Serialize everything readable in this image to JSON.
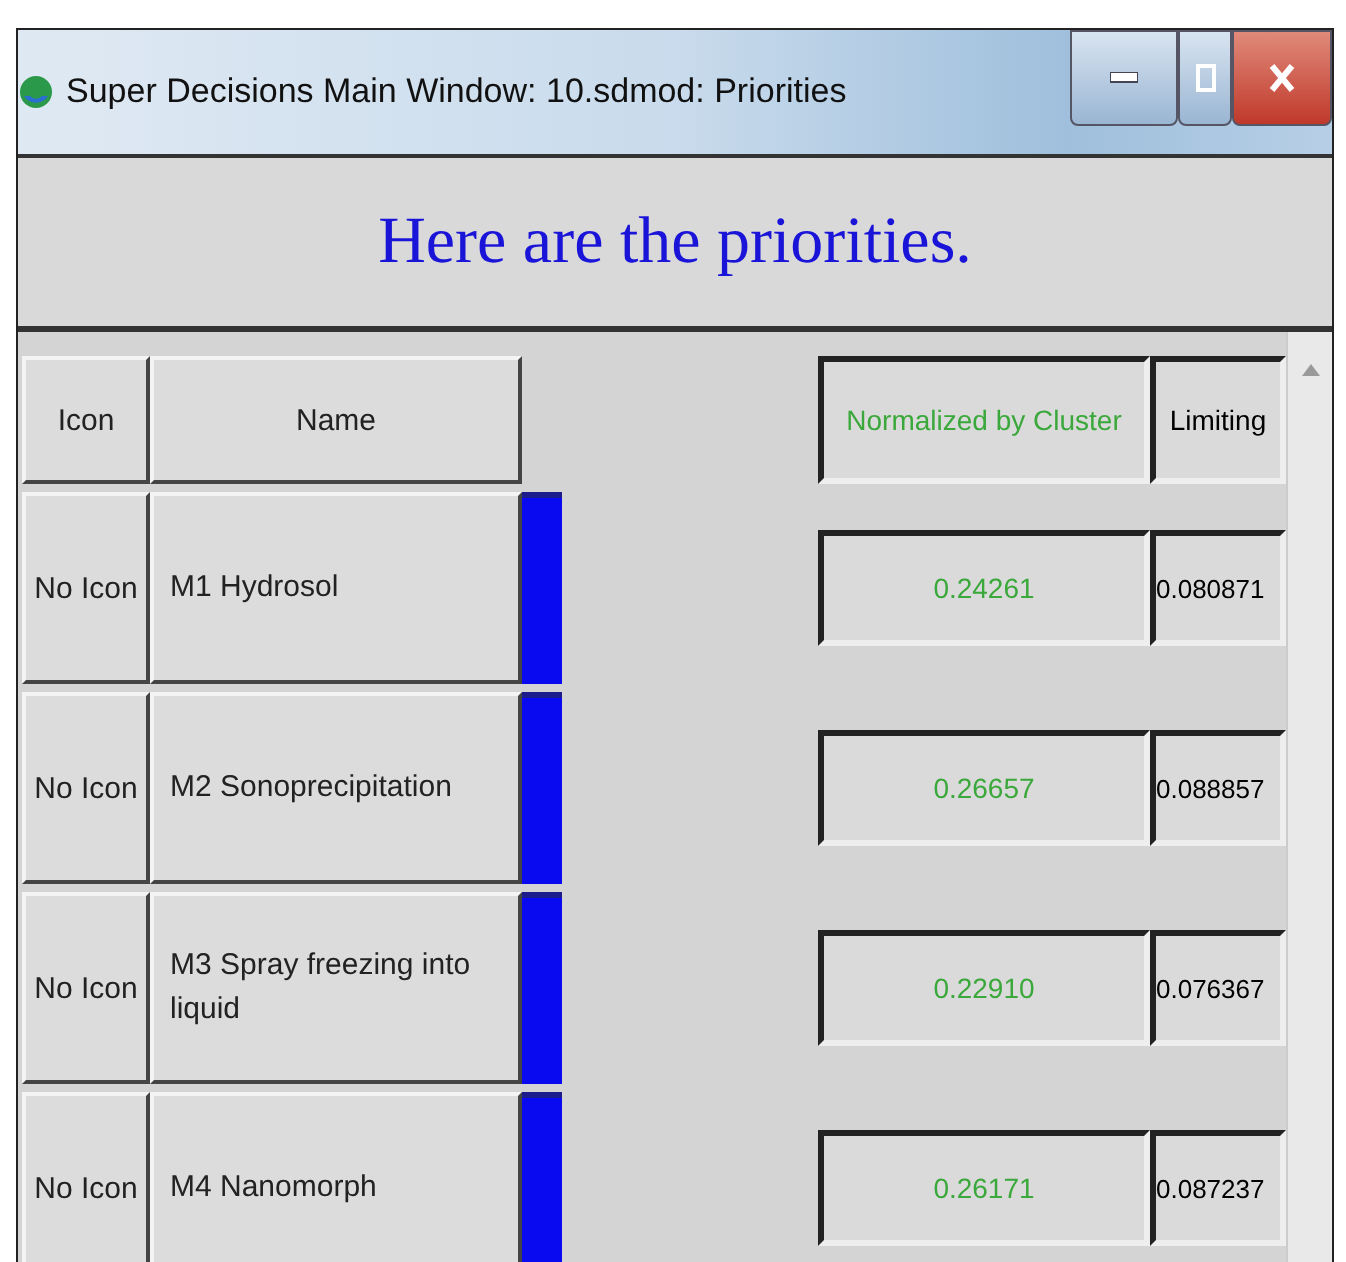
{
  "window": {
    "title": "Super Decisions Main Window: 10.sdmod: Priorities"
  },
  "header": {
    "text": "Here are the priorities."
  },
  "table": {
    "columns": [
      "Icon",
      "Name",
      "Normalized by Cluster",
      "Limiting"
    ],
    "rows": [
      {
        "icon": "No Icon",
        "name": "M1 Hydrosol",
        "normalized": "0.24261",
        "limiting": "0.080871"
      },
      {
        "icon": "No Icon",
        "name": "M2 Sonoprecipitation",
        "normalized": "0.26657",
        "limiting": "0.088857"
      },
      {
        "icon": "No Icon",
        "name": "M3 Spray freezing into liquid",
        "normalized": "0.22910",
        "limiting": "0.076367"
      },
      {
        "icon": "No Icon",
        "name": "M4 Nanomorph",
        "normalized": "0.26171",
        "limiting": "0.087237"
      }
    ]
  }
}
